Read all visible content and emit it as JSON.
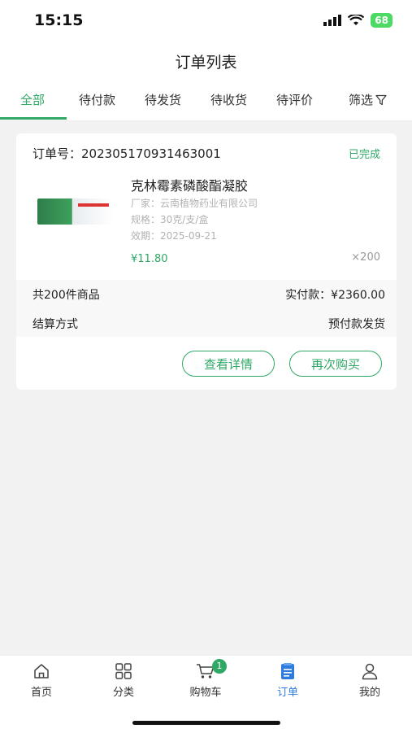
{
  "status_bar": {
    "time": "15:15",
    "battery": "68"
  },
  "header": {
    "title": "订单列表"
  },
  "tabs": [
    {
      "label": "全部",
      "active": true
    },
    {
      "label": "待付款"
    },
    {
      "label": "待发货"
    },
    {
      "label": "待收货"
    },
    {
      "label": "待评价"
    },
    {
      "label": "筛选",
      "icon": "filter-icon"
    }
  ],
  "order": {
    "number_label": "订单号：",
    "number": "202305170931463001",
    "status": "已完成",
    "product": {
      "name": "克林霉素磷酸酯凝胶",
      "manufacturer": "厂家：云南植物药业有限公司",
      "spec": "规格：30克/支/盒",
      "expiry": "效期：2025-09-21",
      "price": "¥11.80",
      "qty": "×200"
    },
    "summary": {
      "count": "共200件商品",
      "paid": "实付款：¥2360.00",
      "settlement_label": "结算方式",
      "settlement_value": "预付款发货"
    },
    "buttons": {
      "detail": "查看详情",
      "rebuy": "再次购买"
    }
  },
  "bottom_nav": [
    {
      "label": "首页",
      "icon": "home-icon"
    },
    {
      "label": "分类",
      "icon": "category-icon"
    },
    {
      "label": "购物车",
      "icon": "cart-icon",
      "badge": "1"
    },
    {
      "label": "订单",
      "icon": "order-icon",
      "active": true
    },
    {
      "label": "我的",
      "icon": "profile-icon"
    }
  ],
  "colors": {
    "accent": "#2fa866",
    "nav_active": "#2f7ce0"
  }
}
